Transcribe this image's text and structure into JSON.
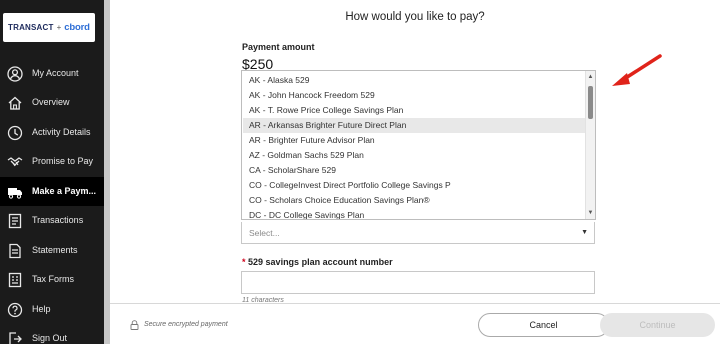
{
  "brand": {
    "left": "TRANSACT",
    "separator": "+",
    "right": "cbord"
  },
  "sidebar": {
    "items": [
      {
        "label": "My Account",
        "icon": "account-icon"
      },
      {
        "label": "Overview",
        "icon": "home-icon"
      },
      {
        "label": "Activity Details",
        "icon": "clock-icon"
      },
      {
        "label": "Promise to Pay",
        "icon": "handshake-icon"
      },
      {
        "label": "Make a Paym...",
        "icon": "truck-icon",
        "active": true
      },
      {
        "label": "Transactions",
        "icon": "receipt-icon"
      },
      {
        "label": "Statements",
        "icon": "document-icon"
      },
      {
        "label": "Tax Forms",
        "icon": "form-icon"
      },
      {
        "label": "Help",
        "icon": "help-icon"
      },
      {
        "label": "Sign Out",
        "icon": "sign-out-icon"
      }
    ]
  },
  "dialog": {
    "title": "How would you like to pay?",
    "payment_amount_label": "Payment amount",
    "payment_amount": "$250"
  },
  "plan_list": {
    "options": [
      "AK - Alaska 529",
      "AK - John Hancock Freedom 529",
      "AK - T. Rowe Price College Savings Plan",
      "AR - Arkansas Brighter Future Direct Plan",
      "AR - Brighter Future Advisor Plan",
      "AZ - Goldman Sachs 529 Plan",
      "CA - ScholarShare 529",
      "CO - CollegeInvest Direct Portfolio College Savings P",
      "CO - Scholars Choice Education Savings Plan®",
      "DC - DC College Savings Plan"
    ],
    "highlighted": "AR - Arkansas Brighter Future Direct Plan"
  },
  "plan_select": {
    "placeholder": "Select..."
  },
  "account_number": {
    "required_mark": "*",
    "label": "529 savings plan account number",
    "helper": "11 characters"
  },
  "footer": {
    "secure_text": "Secure encrypted payment",
    "cancel_label": "Cancel",
    "continue_label": "Continue"
  },
  "colors": {
    "sidebar_bg": "#1b1b1b",
    "active_item_bg": "#000000",
    "annotation_arrow": "#e0231a",
    "required_mark": "#d0021b",
    "highlight_option": "#e8e8e8",
    "continue_disabled": "#e6e6e6"
  }
}
